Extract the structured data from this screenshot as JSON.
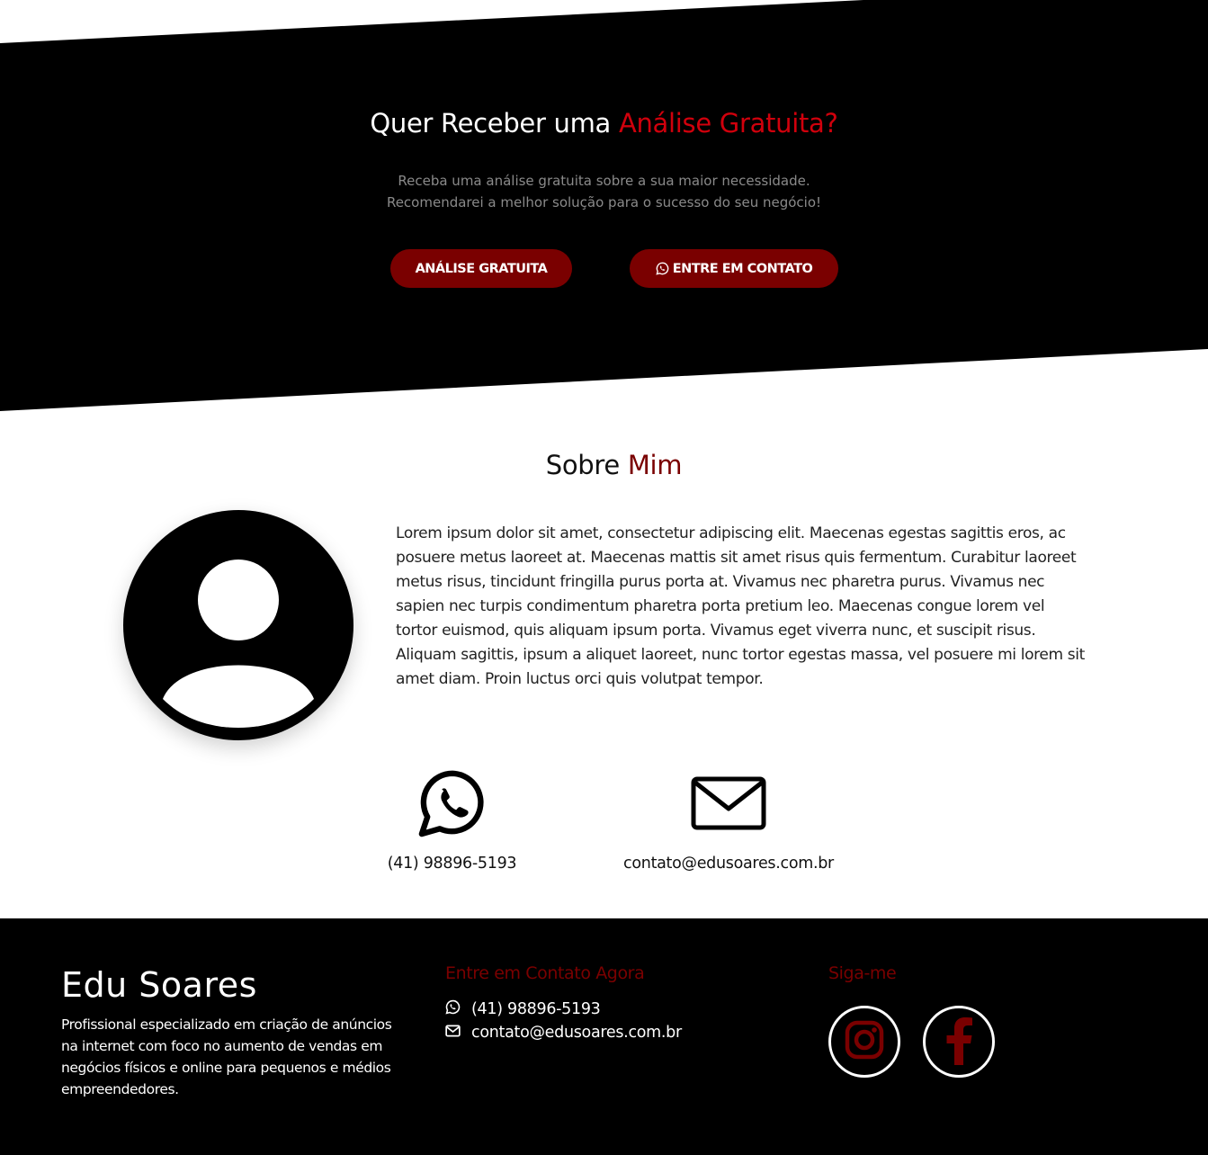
{
  "colors": {
    "background": "#ffffff",
    "dark": "#000000",
    "accent_red": "#d0000c",
    "accent_dark_red": "#7a0000",
    "muted_text": "#8a8a8a"
  },
  "hero": {
    "title_main": "Quer Receber uma ",
    "title_accent": "Análise Gratuita?",
    "subtitle_line1": "Receba uma análise gratuita sobre a sua maior necessidade.",
    "subtitle_line2": "Recomendarei a melhor solução para o sucesso do seu negócio!",
    "button_analise": "ANÁLISE GRATUITA",
    "button_contato": "ENTRE EM CONTATO",
    "button_contato_icon": "whatsapp-icon"
  },
  "about": {
    "title_main": "Sobre ",
    "title_accent": "Mim",
    "avatar_icon": "user-avatar-icon",
    "paragraph": "Lorem ipsum dolor sit amet, consectetur adipiscing elit. Maecenas egestas sagittis eros, ac posuere metus laoreet at. Maecenas mattis sit amet risus quis fermentum. Curabitur laoreet metus risus, tincidunt fringilla purus porta at. Vivamus nec pharetra purus. Vivamus nec sapien nec turpis condimentum pharetra porta pretium leo. Maecenas congue lorem vel tortor euismod, quis aliquam ipsum porta. Vivamus eget viverra nunc, et suscipit risus. Aliquam sagittis, ipsum a aliquet laoreet, nunc tortor egestas massa, vel posuere mi lorem sit amet diam. Proin luctus orci quis volutpat tempor.",
    "phone_icon": "whatsapp-icon",
    "phone": "(41) 98896-5193",
    "email_icon": "envelope-icon",
    "email": "contato@edusoares.com.br"
  },
  "footer": {
    "brand": "Edu Soares",
    "description": "Profissional especializado em criação de anúncios na internet com foco no aumento de vendas em negócios físicos e online para pequenos e médios empreendedores.",
    "contact_title": "Entre em Contato Agora",
    "phone": "(41) 98896-5193",
    "email": "contato@edusoares.com.br",
    "social_title": "Siga-me",
    "social": [
      {
        "name": "Instagram",
        "icon": "instagram-icon"
      },
      {
        "name": "Facebook",
        "icon": "facebook-icon"
      }
    ]
  }
}
